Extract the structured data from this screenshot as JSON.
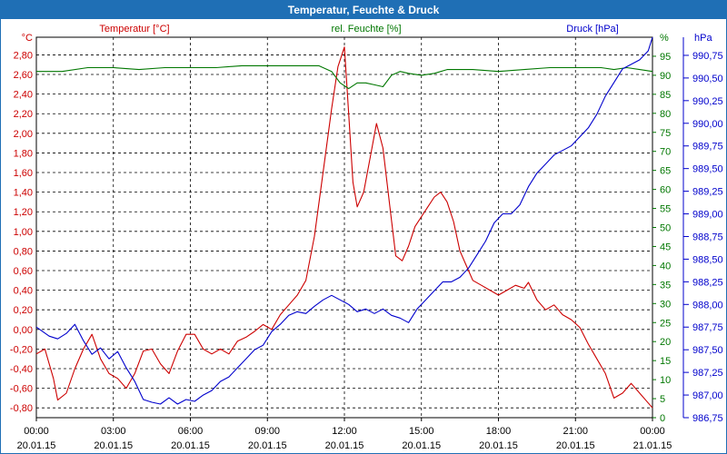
{
  "window": {
    "title": "Temperatur, Feuchte & Druck"
  },
  "colors": {
    "temperature": "#cc0000",
    "humidity": "#007700",
    "pressure": "#0000cc",
    "titlebar": "#1f6fb5",
    "axis_text": "#000000"
  },
  "chart_data": {
    "type": "line",
    "title": "Temperatur, Feuchte & Druck",
    "grid": true,
    "x": {
      "label": "",
      "range": [
        "20.01.15 00:00",
        "21.01.15 00:00"
      ],
      "ticks": [
        {
          "time": "00:00",
          "date": "20.01.15"
        },
        {
          "time": "03:00",
          "date": "20.01.15"
        },
        {
          "time": "06:00",
          "date": "20.01.15"
        },
        {
          "time": "09:00",
          "date": "20.01.15"
        },
        {
          "time": "12:00",
          "date": "20.01.15"
        },
        {
          "time": "15:00",
          "date": "20.01.15"
        },
        {
          "time": "18:00",
          "date": "20.01.15"
        },
        {
          "time": "21:00",
          "date": "20.01.15"
        },
        {
          "time": "00:00",
          "date": "21.01.15"
        }
      ]
    },
    "axes": {
      "temperature": {
        "unit": "°C",
        "header": "Temperatur [°C]",
        "range": [
          -0.9,
          2.98
        ],
        "ticks": [
          "2,80",
          "2,60",
          "2,40",
          "2,20",
          "2,00",
          "1,80",
          "1,60",
          "1,40",
          "1,20",
          "1,00",
          "0,80",
          "0,60",
          "0,40",
          "0,20",
          "0,00",
          "-0,20",
          "-0,40",
          "-0,60",
          "-0,80"
        ]
      },
      "humidity": {
        "unit": "%",
        "header": "rel. Feuchte [%]",
        "range": [
          0,
          100
        ],
        "ticks": [
          "95",
          "90",
          "85",
          "80",
          "75",
          "70",
          "65",
          "60",
          "55",
          "50",
          "45",
          "40",
          "35",
          "30",
          "25",
          "20",
          "15",
          "10",
          "5",
          "0"
        ]
      },
      "pressure": {
        "unit": "hPa",
        "header": "Druck [hPa]",
        "range": [
          986.75,
          990.95
        ],
        "ticks": [
          "990,75",
          "990,50",
          "990,25",
          "990,00",
          "989,75",
          "989,50",
          "989,25",
          "989,00",
          "988,75",
          "988,50",
          "988,25",
          "988,00",
          "987,75",
          "987,50",
          "987,25",
          "987,00",
          "986,75"
        ]
      }
    },
    "series": [
      {
        "name": "Temperatur [°C]",
        "axis": "temperature",
        "points": [
          {
            "t": "00:00",
            "v": -0.25
          },
          {
            "t": "00:20",
            "v": -0.2
          },
          {
            "t": "00:40",
            "v": -0.5
          },
          {
            "t": "00:50",
            "v": -0.72
          },
          {
            "t": "01:10",
            "v": -0.65
          },
          {
            "t": "01:30",
            "v": -0.4
          },
          {
            "t": "01:50",
            "v": -0.2
          },
          {
            "t": "02:10",
            "v": -0.05
          },
          {
            "t": "02:30",
            "v": -0.3
          },
          {
            "t": "02:50",
            "v": -0.45
          },
          {
            "t": "03:10",
            "v": -0.5
          },
          {
            "t": "03:30",
            "v": -0.6
          },
          {
            "t": "03:50",
            "v": -0.45
          },
          {
            "t": "04:10",
            "v": -0.22
          },
          {
            "t": "04:30",
            "v": -0.2
          },
          {
            "t": "04:50",
            "v": -0.35
          },
          {
            "t": "05:10",
            "v": -0.45
          },
          {
            "t": "05:30",
            "v": -0.22
          },
          {
            "t": "05:50",
            "v": -0.05
          },
          {
            "t": "06:10",
            "v": -0.05
          },
          {
            "t": "06:30",
            "v": -0.2
          },
          {
            "t": "06:50",
            "v": -0.25
          },
          {
            "t": "07:10",
            "v": -0.2
          },
          {
            "t": "07:30",
            "v": -0.25
          },
          {
            "t": "07:50",
            "v": -0.12
          },
          {
            "t": "08:10",
            "v": -0.08
          },
          {
            "t": "08:30",
            "v": -0.02
          },
          {
            "t": "08:50",
            "v": 0.05
          },
          {
            "t": "09:10",
            "v": 0.0
          },
          {
            "t": "09:30",
            "v": 0.15
          },
          {
            "t": "09:50",
            "v": 0.25
          },
          {
            "t": "10:10",
            "v": 0.35
          },
          {
            "t": "10:30",
            "v": 0.5
          },
          {
            "t": "10:50",
            "v": 0.95
          },
          {
            "t": "11:10",
            "v": 1.6
          },
          {
            "t": "11:30",
            "v": 2.25
          },
          {
            "t": "11:45",
            "v": 2.68
          },
          {
            "t": "12:00",
            "v": 2.88
          },
          {
            "t": "12:10",
            "v": 2.2
          },
          {
            "t": "12:20",
            "v": 1.5
          },
          {
            "t": "12:30",
            "v": 1.25
          },
          {
            "t": "12:45",
            "v": 1.4
          },
          {
            "t": "13:00",
            "v": 1.75
          },
          {
            "t": "13:15",
            "v": 2.1
          },
          {
            "t": "13:30",
            "v": 1.85
          },
          {
            "t": "13:45",
            "v": 1.3
          },
          {
            "t": "14:00",
            "v": 0.75
          },
          {
            "t": "14:15",
            "v": 0.7
          },
          {
            "t": "14:30",
            "v": 0.85
          },
          {
            "t": "14:45",
            "v": 1.05
          },
          {
            "t": "15:00",
            "v": 1.15
          },
          {
            "t": "15:15",
            "v": 1.25
          },
          {
            "t": "15:30",
            "v": 1.35
          },
          {
            "t": "15:45",
            "v": 1.4
          },
          {
            "t": "16:00",
            "v": 1.3
          },
          {
            "t": "16:15",
            "v": 1.1
          },
          {
            "t": "16:30",
            "v": 0.8
          },
          {
            "t": "16:45",
            "v": 0.65
          },
          {
            "t": "17:00",
            "v": 0.5
          },
          {
            "t": "17:20",
            "v": 0.45
          },
          {
            "t": "17:40",
            "v": 0.4
          },
          {
            "t": "18:00",
            "v": 0.35
          },
          {
            "t": "18:20",
            "v": 0.4
          },
          {
            "t": "18:40",
            "v": 0.45
          },
          {
            "t": "19:00",
            "v": 0.42
          },
          {
            "t": "19:10",
            "v": 0.48
          },
          {
            "t": "19:30",
            "v": 0.3
          },
          {
            "t": "19:50",
            "v": 0.2
          },
          {
            "t": "20:10",
            "v": 0.25
          },
          {
            "t": "20:30",
            "v": 0.15
          },
          {
            "t": "20:50",
            "v": 0.1
          },
          {
            "t": "21:10",
            "v": 0.02
          },
          {
            "t": "21:30",
            "v": -0.15
          },
          {
            "t": "21:50",
            "v": -0.3
          },
          {
            "t": "22:10",
            "v": -0.45
          },
          {
            "t": "22:30",
            "v": -0.7
          },
          {
            "t": "22:50",
            "v": -0.65
          },
          {
            "t": "23:10",
            "v": -0.55
          },
          {
            "t": "23:30",
            "v": -0.65
          },
          {
            "t": "23:50",
            "v": -0.75
          },
          {
            "t": "24:00",
            "v": -0.8
          }
        ]
      },
      {
        "name": "rel. Feuchte [%]",
        "axis": "humidity",
        "points": [
          {
            "t": "00:00",
            "v": 91
          },
          {
            "t": "01:00",
            "v": 91
          },
          {
            "t": "02:00",
            "v": 92
          },
          {
            "t": "03:00",
            "v": 92
          },
          {
            "t": "04:00",
            "v": 91.5
          },
          {
            "t": "05:00",
            "v": 92
          },
          {
            "t": "06:00",
            "v": 92
          },
          {
            "t": "07:00",
            "v": 92
          },
          {
            "t": "08:00",
            "v": 92.5
          },
          {
            "t": "09:00",
            "v": 92.5
          },
          {
            "t": "10:00",
            "v": 92.5
          },
          {
            "t": "11:00",
            "v": 92.5
          },
          {
            "t": "11:30",
            "v": 91
          },
          {
            "t": "11:50",
            "v": 88
          },
          {
            "t": "12:10",
            "v": 86.5
          },
          {
            "t": "12:30",
            "v": 88
          },
          {
            "t": "12:50",
            "v": 88
          },
          {
            "t": "13:10",
            "v": 87.5
          },
          {
            "t": "13:30",
            "v": 87
          },
          {
            "t": "13:50",
            "v": 90
          },
          {
            "t": "14:10",
            "v": 91
          },
          {
            "t": "14:30",
            "v": 90.5
          },
          {
            "t": "15:00",
            "v": 90
          },
          {
            "t": "15:30",
            "v": 90.5
          },
          {
            "t": "16:00",
            "v": 91.5
          },
          {
            "t": "17:00",
            "v": 91.5
          },
          {
            "t": "18:00",
            "v": 91
          },
          {
            "t": "19:00",
            "v": 91.5
          },
          {
            "t": "20:00",
            "v": 92
          },
          {
            "t": "21:00",
            "v": 92
          },
          {
            "t": "22:00",
            "v": 92
          },
          {
            "t": "22:30",
            "v": 91.5
          },
          {
            "t": "23:00",
            "v": 92
          },
          {
            "t": "23:30",
            "v": 91.5
          },
          {
            "t": "24:00",
            "v": 91
          }
        ]
      },
      {
        "name": "Druck [hPa]",
        "axis": "pressure",
        "points": [
          {
            "t": "00:00",
            "v": 987.75
          },
          {
            "t": "00:30",
            "v": 987.65
          },
          {
            "t": "00:50",
            "v": 987.62
          },
          {
            "t": "01:10",
            "v": 987.68
          },
          {
            "t": "01:30",
            "v": 987.78
          },
          {
            "t": "01:50",
            "v": 987.6
          },
          {
            "t": "02:10",
            "v": 987.45
          },
          {
            "t": "02:30",
            "v": 987.52
          },
          {
            "t": "02:50",
            "v": 987.4
          },
          {
            "t": "03:10",
            "v": 987.48
          },
          {
            "t": "03:30",
            "v": 987.3
          },
          {
            "t": "03:50",
            "v": 987.15
          },
          {
            "t": "04:10",
            "v": 986.95
          },
          {
            "t": "04:30",
            "v": 986.92
          },
          {
            "t": "04:50",
            "v": 986.9
          },
          {
            "t": "05:10",
            "v": 986.97
          },
          {
            "t": "05:30",
            "v": 986.9
          },
          {
            "t": "05:50",
            "v": 986.95
          },
          {
            "t": "06:10",
            "v": 986.93
          },
          {
            "t": "06:30",
            "v": 987.0
          },
          {
            "t": "06:50",
            "v": 987.05
          },
          {
            "t": "07:10",
            "v": 987.15
          },
          {
            "t": "07:30",
            "v": 987.2
          },
          {
            "t": "07:50",
            "v": 987.3
          },
          {
            "t": "08:10",
            "v": 987.4
          },
          {
            "t": "08:30",
            "v": 987.5
          },
          {
            "t": "08:50",
            "v": 987.55
          },
          {
            "t": "09:10",
            "v": 987.7
          },
          {
            "t": "09:30",
            "v": 987.78
          },
          {
            "t": "09:50",
            "v": 987.88
          },
          {
            "t": "10:10",
            "v": 987.92
          },
          {
            "t": "10:30",
            "v": 987.9
          },
          {
            "t": "10:50",
            "v": 987.98
          },
          {
            "t": "11:10",
            "v": 988.05
          },
          {
            "t": "11:30",
            "v": 988.1
          },
          {
            "t": "11:50",
            "v": 988.05
          },
          {
            "t": "12:10",
            "v": 988.0
          },
          {
            "t": "12:30",
            "v": 987.92
          },
          {
            "t": "12:50",
            "v": 987.95
          },
          {
            "t": "13:10",
            "v": 987.9
          },
          {
            "t": "13:30",
            "v": 987.95
          },
          {
            "t": "13:50",
            "v": 987.88
          },
          {
            "t": "14:10",
            "v": 987.85
          },
          {
            "t": "14:30",
            "v": 987.8
          },
          {
            "t": "14:50",
            "v": 987.95
          },
          {
            "t": "15:10",
            "v": 988.05
          },
          {
            "t": "15:30",
            "v": 988.15
          },
          {
            "t": "15:50",
            "v": 988.25
          },
          {
            "t": "16:10",
            "v": 988.25
          },
          {
            "t": "16:30",
            "v": 988.3
          },
          {
            "t": "16:50",
            "v": 988.4
          },
          {
            "t": "17:10",
            "v": 988.55
          },
          {
            "t": "17:30",
            "v": 988.7
          },
          {
            "t": "17:50",
            "v": 988.9
          },
          {
            "t": "18:10",
            "v": 989.0
          },
          {
            "t": "18:30",
            "v": 989.0
          },
          {
            "t": "18:50",
            "v": 989.1
          },
          {
            "t": "19:10",
            "v": 989.3
          },
          {
            "t": "19:30",
            "v": 989.45
          },
          {
            "t": "19:50",
            "v": 989.55
          },
          {
            "t": "20:10",
            "v": 989.65
          },
          {
            "t": "20:30",
            "v": 989.7
          },
          {
            "t": "20:50",
            "v": 989.75
          },
          {
            "t": "21:10",
            "v": 989.85
          },
          {
            "t": "21:30",
            "v": 989.95
          },
          {
            "t": "21:50",
            "v": 990.1
          },
          {
            "t": "22:10",
            "v": 990.3
          },
          {
            "t": "22:30",
            "v": 990.45
          },
          {
            "t": "22:50",
            "v": 990.6
          },
          {
            "t": "23:10",
            "v": 990.65
          },
          {
            "t": "23:30",
            "v": 990.7
          },
          {
            "t": "23:50",
            "v": 990.8
          },
          {
            "t": "24:00",
            "v": 990.95
          }
        ]
      }
    ]
  }
}
